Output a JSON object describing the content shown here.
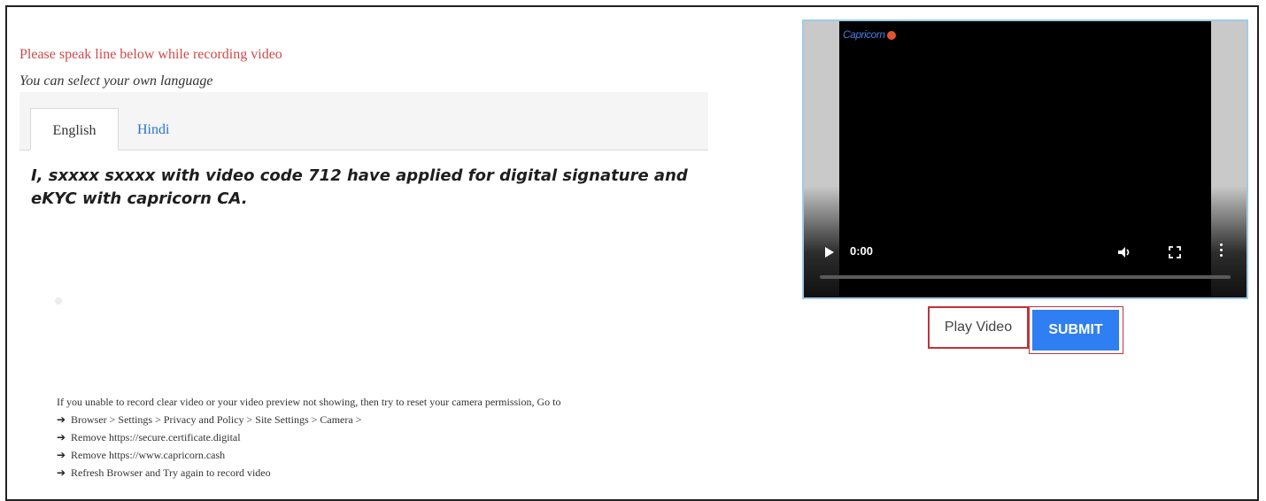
{
  "instruction": {
    "main": "Please speak line below while recording video",
    "sub": "You can select your own language"
  },
  "tabs": [
    {
      "label": "English",
      "active": true
    },
    {
      "label": "Hindi",
      "active": false
    }
  ],
  "statement": "I, sxxxx  sxxxx  with video code 712 have applied for digital signature and eKYC with capricorn CA.",
  "help": {
    "intro": "If you unable to record clear video or your video preview not showing, then try to reset your camera permission, Go to",
    "steps": [
      "Browser > Settings > Privacy and Policy > Site Settings > Camera >",
      "Remove https://secure.certificate.digital",
      "Remove https://www.capricorn.cash",
      "Refresh Browser and Try again to record video"
    ]
  },
  "video": {
    "logo_text": "Capricorn",
    "time": "0:00",
    "progress": 0
  },
  "buttons": {
    "play_video": "Play Video",
    "submit": "SUBMIT"
  },
  "colors": {
    "instruction": "#d04848",
    "tab_link": "#2e72c8",
    "submit_bg": "#2f7ff2",
    "highlight_border": "#c0333a"
  },
  "icons": {
    "play": "play-icon",
    "volume": "volume-icon",
    "fullscreen": "fullscreen-icon",
    "more": "more-options-icon",
    "arrow": "arrow-right-icon"
  }
}
